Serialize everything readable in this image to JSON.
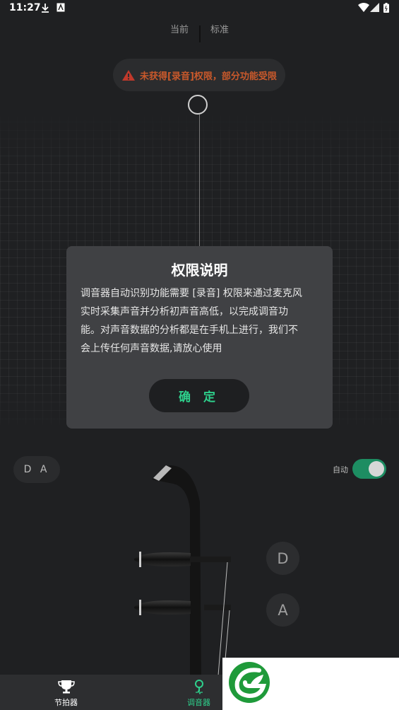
{
  "status_bar": {
    "time": "11:27",
    "icons": [
      "download-icon",
      "notification-icon",
      "wifi-icon",
      "signal-icon",
      "battery-icon"
    ]
  },
  "mode_tabs": {
    "current": "当前",
    "standard": "标准"
  },
  "warning": {
    "text": "未获得[录音]权限，部分功能受限",
    "icon": "warning-icon",
    "color": "#c9592b"
  },
  "dialog": {
    "title": "权限说明",
    "body_lines": [
      "调音器自动识别功能需要 [录音] 权限来通过麦克风",
      "实时采集声音并分析初声音高低，以完成调音功",
      "能。对声音数据的分析都是在手机上进行，我们不",
      "会上传任何声音数据,请放心使用"
    ],
    "confirm_label": "确 定"
  },
  "tuner": {
    "string_selector": "D A",
    "auto_label": "自动",
    "auto_enabled": true,
    "notes": [
      "D",
      "A"
    ],
    "accent": "#1d8d62"
  },
  "bottom_nav": {
    "items": [
      {
        "label": "节拍器",
        "icon": "trophy-icon",
        "active": false
      },
      {
        "label": "调音器",
        "icon": "tuner-pin-icon",
        "active": true
      }
    ],
    "active_color": "#2ed08c"
  },
  "ad": {
    "logo": "leaf-logo"
  }
}
